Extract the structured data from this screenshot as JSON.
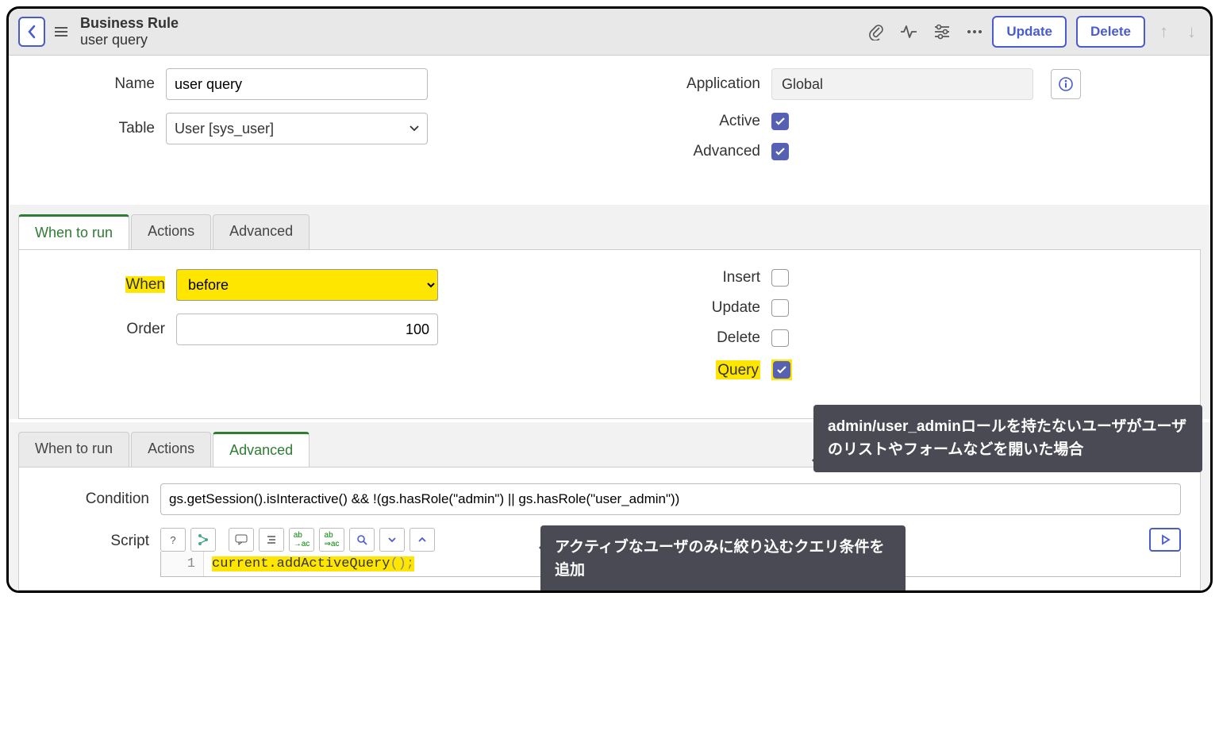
{
  "header": {
    "title": "Business Rule",
    "subtitle": "user query",
    "update": "Update",
    "delete": "Delete"
  },
  "form": {
    "name_label": "Name",
    "name_value": "user query",
    "table_label": "Table",
    "table_value": "User [sys_user]",
    "app_label": "Application",
    "app_value": "Global",
    "active_label": "Active",
    "advanced_label": "Advanced"
  },
  "tabs1": {
    "t1": "When to run",
    "t2": "Actions",
    "t3": "Advanced"
  },
  "when": {
    "when_label": "When",
    "when_value": "before",
    "order_label": "Order",
    "order_value": "100",
    "insert_label": "Insert",
    "update_label": "Update",
    "delete_label": "Delete",
    "query_label": "Query"
  },
  "tabs2": {
    "t1": "When to run",
    "t2": "Actions",
    "t3": "Advanced"
  },
  "adv": {
    "cond_label": "Condition",
    "cond_value": "gs.getSession().isInteractive() && !(gs.hasRole(\"admin\") || gs.hasRole(\"user_admin\"))",
    "script_label": "Script",
    "line_no": "1",
    "code_pre": "current.addActiveQuery",
    "code_paren": "();"
  },
  "callouts": {
    "c1": "admin/user_adminロールを持たないユーザがユーザのリストやフォームなどを開いた場合",
    "c2": "アクティブなユーザのみに絞り込むクエリ条件を追加"
  }
}
